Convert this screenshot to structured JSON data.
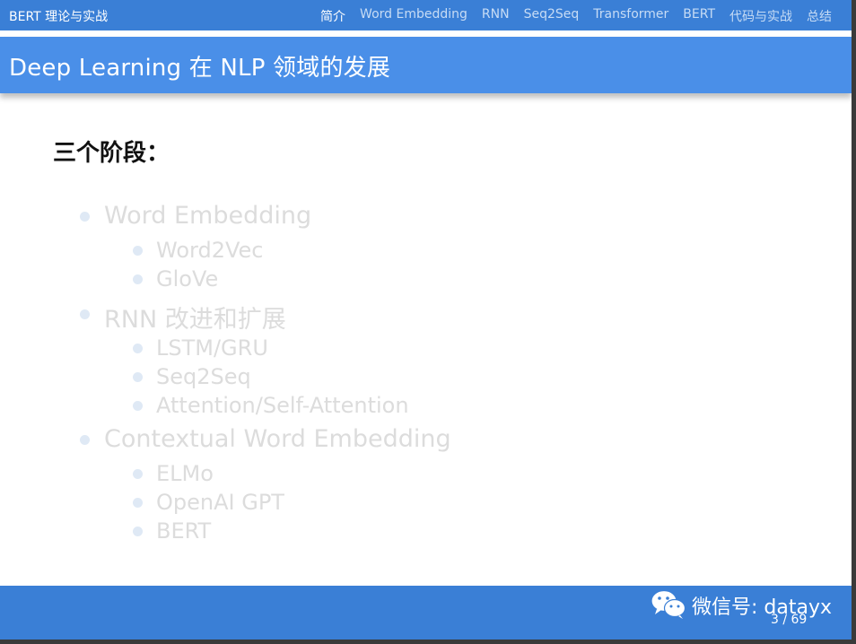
{
  "header": {
    "brand": "BERT 理论与实战",
    "nav": [
      {
        "label": "简介",
        "active": true
      },
      {
        "label": "Word Embedding",
        "active": false
      },
      {
        "label": "RNN",
        "active": false
      },
      {
        "label": "Seq2Seq",
        "active": false
      },
      {
        "label": "Transformer",
        "active": false
      },
      {
        "label": "BERT",
        "active": false
      },
      {
        "label": "代码与实战",
        "active": false
      },
      {
        "label": "总结",
        "active": false
      }
    ]
  },
  "slide": {
    "title": "Deep Learning 在 NLP 领域的发展",
    "heading": "三个阶段：",
    "outline": [
      {
        "label": "Word Embedding",
        "children": [
          "Word2Vec",
          "GloVe"
        ]
      },
      {
        "label": "RNN 改进和扩展",
        "children": [
          "LSTM/GRU",
          "Seq2Seq",
          "Attention/Self-Attention"
        ]
      },
      {
        "label": "Contextual Word Embedding",
        "children": [
          "ELMo",
          "OpenAI GPT",
          "BERT"
        ]
      }
    ]
  },
  "footer": {
    "watermark": "微信号: datayx",
    "page": "3 / 69"
  },
  "colors": {
    "nav_bar": "#3a7fd6",
    "title_bar": "#4a8fe8",
    "dimmed_text": "#dcdcdc",
    "bullet": "#dfe9f5"
  },
  "icons": {
    "watermark_icon": "wechat-icon"
  }
}
